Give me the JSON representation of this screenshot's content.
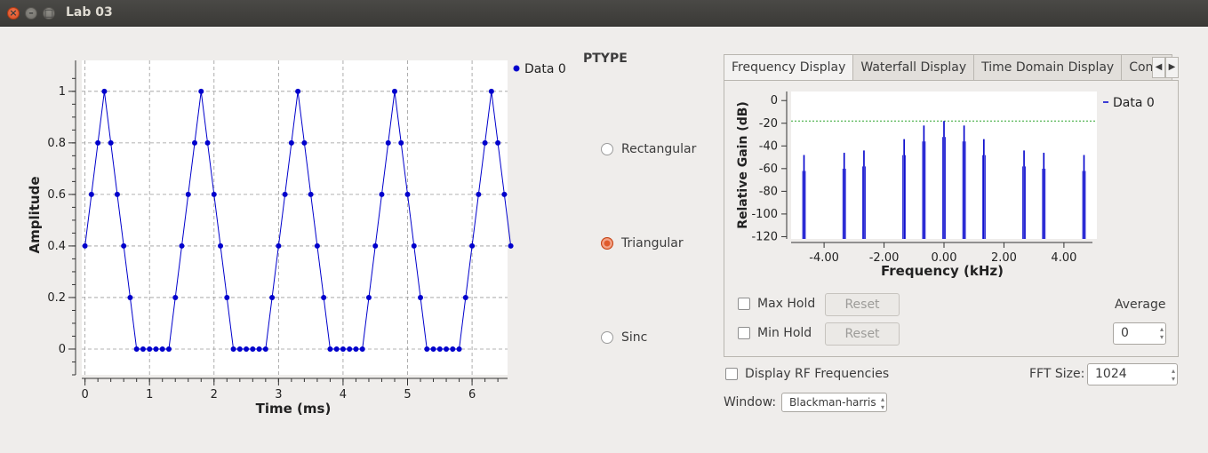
{
  "window": {
    "title": "Lab 03"
  },
  "time_plot": {
    "legend": "Data 0",
    "xlabel": "Time (ms)",
    "ylabel": "Amplitude",
    "xticks": [
      "0",
      "1",
      "2",
      "3",
      "4",
      "5",
      "6"
    ],
    "yticks": [
      "0",
      "0.2",
      "0.4",
      "0.6",
      "0.8",
      "1"
    ]
  },
  "ptype": {
    "label": "PTYPE",
    "options": [
      "Rectangular",
      "Triangular",
      "Sinc"
    ],
    "selected": "Triangular"
  },
  "tabs": [
    "Frequency Display",
    "Waterfall Display",
    "Time Domain Display",
    "Const"
  ],
  "active_tab": "Frequency Display",
  "freq_plot": {
    "legend": "Data 0",
    "xlabel": "Frequency (kHz)",
    "ylabel": "Relative Gain (dB)",
    "xticks": [
      "-4.00",
      "-2.00",
      "0.00",
      "2.00",
      "4.00"
    ],
    "yticks": [
      "0",
      "-20",
      "-40",
      "-60",
      "-80",
      "-100",
      "-120"
    ]
  },
  "controls": {
    "max_hold": "Max Hold",
    "min_hold": "Min Hold",
    "reset": "Reset",
    "average_label": "Average",
    "average_value": "0",
    "display_rf": "Display RF Frequencies",
    "fft_label": "FFT Size:",
    "fft_value": "1024",
    "window_label": "Window:",
    "window_value": "Blackman-harris"
  },
  "colors": {
    "trace": "#0000cc",
    "grid": "#9a9a9a",
    "threshold": "#2ea42e",
    "accent": "#e05a2b"
  },
  "chart_data": [
    {
      "type": "line",
      "title": "",
      "xlabel": "Time (ms)",
      "ylabel": "Amplitude",
      "xlim": [
        -0.05,
        6.55
      ],
      "ylim": [
        -0.1,
        1.12
      ],
      "grid": true,
      "legend": "top-right",
      "series": [
        {
          "name": "Data 0",
          "x": [
            0,
            0.1,
            0.2,
            0.3,
            0.4,
            0.5,
            0.6,
            0.7,
            0.8,
            0.9,
            1.0,
            1.1,
            1.2,
            1.3,
            1.4,
            1.5,
            1.6,
            1.7,
            1.8,
            1.9,
            2.0,
            2.1,
            2.2,
            2.3,
            2.4,
            2.5,
            2.6,
            2.7,
            2.8,
            2.9,
            3.0,
            3.1,
            3.2,
            3.3,
            3.4,
            3.5,
            3.6,
            3.7,
            3.8,
            3.9,
            4.0,
            4.1,
            4.2,
            4.3,
            4.4,
            4.5,
            4.6,
            4.7,
            4.8,
            4.9,
            5.0,
            5.1,
            5.2,
            5.3,
            5.4,
            5.5,
            5.6,
            5.7,
            5.8,
            5.9,
            6.0,
            6.1,
            6.2,
            6.3,
            6.4,
            6.5,
            6.6
          ],
          "y": [
            0.4,
            0.6,
            0.8,
            1.0,
            0.8,
            0.6,
            0.4,
            0.2,
            0,
            0,
            0,
            0,
            0,
            0,
            0.2,
            0.4,
            0.6,
            0.8,
            1.0,
            0.8,
            0.6,
            0.4,
            0.2,
            0,
            0,
            0,
            0,
            0,
            0,
            0.2,
            0.4,
            0.6,
            0.8,
            1.0,
            0.8,
            0.6,
            0.4,
            0.2,
            0,
            0,
            0,
            0,
            0,
            0,
            0.2,
            0.4,
            0.6,
            0.8,
            1.0,
            0.8,
            0.6,
            0.4,
            0.2,
            0,
            0,
            0,
            0,
            0,
            0,
            0.2,
            0.4,
            0.6,
            0.8,
            1.0,
            0.8,
            0.6,
            0.4
          ]
        }
      ]
    },
    {
      "type": "line",
      "title": "",
      "xlabel": "Frequency (kHz)",
      "ylabel": "Relative Gain (dB)",
      "xlim": [
        -5.1,
        5.1
      ],
      "ylim": [
        -122,
        8
      ],
      "grid": false,
      "legend": "top-right",
      "threshold_db": -18,
      "series": [
        {
          "name": "Data 0",
          "peaks_x": [
            -4.67,
            -3.33,
            -2.67,
            -1.33,
            -0.67,
            0,
            0.67,
            1.33,
            2.67,
            3.33,
            4.67
          ],
          "peaks_db": [
            -48,
            -46,
            -44,
            -34,
            -22,
            -18,
            -22,
            -34,
            -44,
            -46,
            -48
          ]
        }
      ]
    }
  ]
}
